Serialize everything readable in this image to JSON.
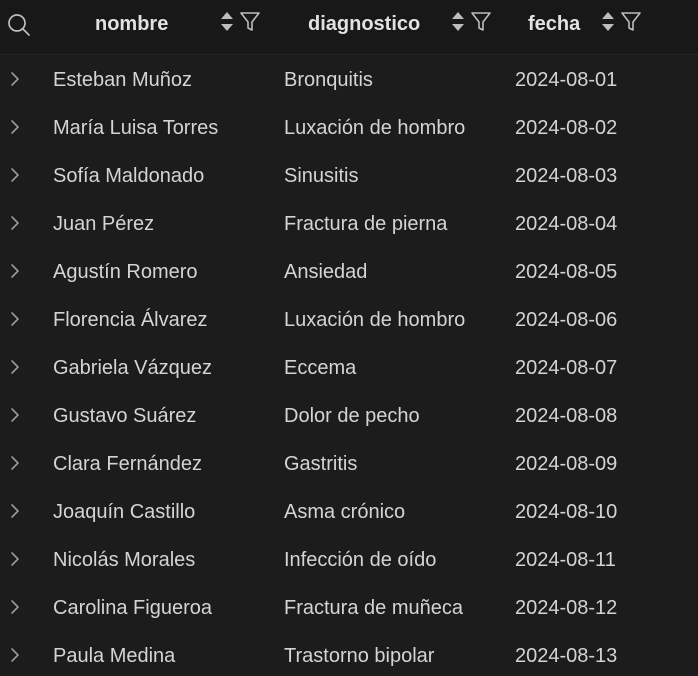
{
  "table": {
    "columns": [
      {
        "key": "nombre",
        "label": "nombre"
      },
      {
        "key": "diagnostico",
        "label": "diagnostico"
      },
      {
        "key": "fecha",
        "label": "fecha"
      }
    ],
    "rows": [
      {
        "nombre": "Esteban Muñoz",
        "diagnostico": "Bronquitis",
        "fecha": "2024-08-01"
      },
      {
        "nombre": "María Luisa Torres",
        "diagnostico": "Luxación de hombro",
        "fecha": "2024-08-02"
      },
      {
        "nombre": "Sofía Maldonado",
        "diagnostico": "Sinusitis",
        "fecha": "2024-08-03"
      },
      {
        "nombre": "Juan Pérez",
        "diagnostico": "Fractura de pierna",
        "fecha": "2024-08-04"
      },
      {
        "nombre": "Agustín Romero",
        "diagnostico": "Ansiedad",
        "fecha": "2024-08-05"
      },
      {
        "nombre": "Florencia Álvarez",
        "diagnostico": "Luxación de hombro",
        "fecha": "2024-08-06"
      },
      {
        "nombre": "Gabriela Vázquez",
        "diagnostico": "Eccema",
        "fecha": "2024-08-07"
      },
      {
        "nombre": "Gustavo Suárez",
        "diagnostico": "Dolor de pecho",
        "fecha": "2024-08-08"
      },
      {
        "nombre": "Clara Fernández",
        "diagnostico": "Gastritis",
        "fecha": "2024-08-09"
      },
      {
        "nombre": "Joaquín Castillo",
        "diagnostico": "Asma crónico",
        "fecha": "2024-08-10"
      },
      {
        "nombre": "Nicolás Morales",
        "diagnostico": "Infección de oído",
        "fecha": "2024-08-11"
      },
      {
        "nombre": "Carolina Figueroa",
        "diagnostico": "Fractura de muñeca",
        "fecha": "2024-08-12"
      },
      {
        "nombre": "Paula Medina",
        "diagnostico": "Trastorno bipolar",
        "fecha": "2024-08-13"
      }
    ]
  },
  "icons": {
    "search": "search-icon",
    "sort": "sort-icon",
    "filter": "filter-icon",
    "expand": "chevron-right-icon"
  },
  "colors": {
    "background": "#1c1c1c",
    "header_background": "#181818",
    "header_text": "#e2e2e2",
    "cell_text": "#d4d4d4",
    "icon": "#bdbdbd"
  }
}
